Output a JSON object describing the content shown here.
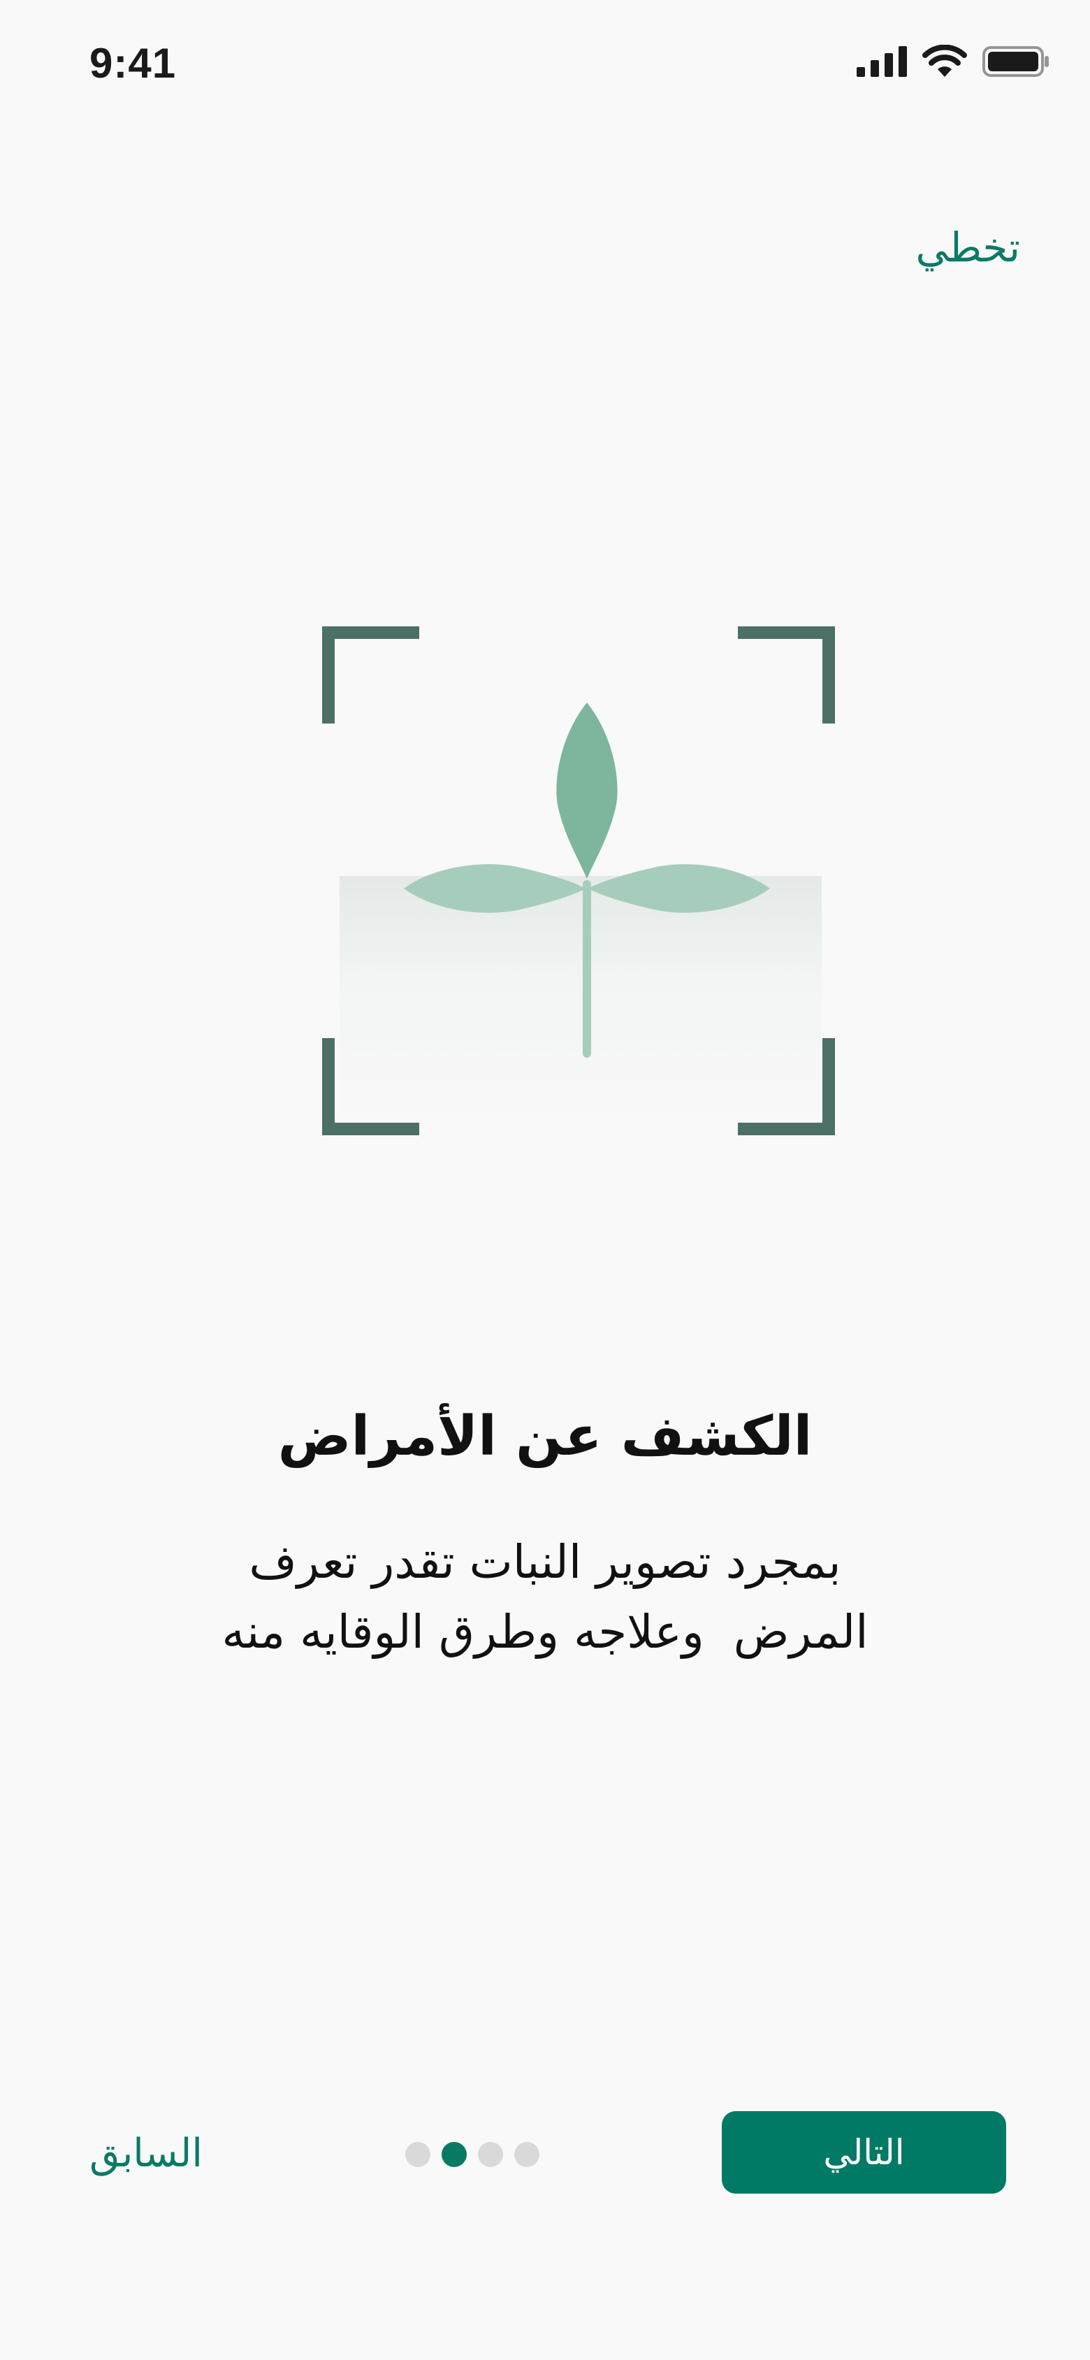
{
  "status_bar": {
    "time": "9:41",
    "icons": [
      "cellular-signal-icon",
      "wifi-icon",
      "battery-icon"
    ]
  },
  "onboarding": {
    "skip_label": "تخطي",
    "illustration": "plant-scan-icon",
    "title": "الكشف عن الأمراض",
    "description_line1": "بمجرد تصوير النبات تقدر تعرف",
    "description_line2": "المرض  وعلاجه وطرق الوقايه منه",
    "page_indicator": {
      "current": 2,
      "total": 4
    },
    "next_label": "التالي",
    "previous_label": "السابق"
  },
  "colors": {
    "accent": "#007a64",
    "frame": "#4d7066",
    "leaf_dark": "#7db59d",
    "leaf_light": "#a6cdbc",
    "background": "#f9f9f9"
  }
}
